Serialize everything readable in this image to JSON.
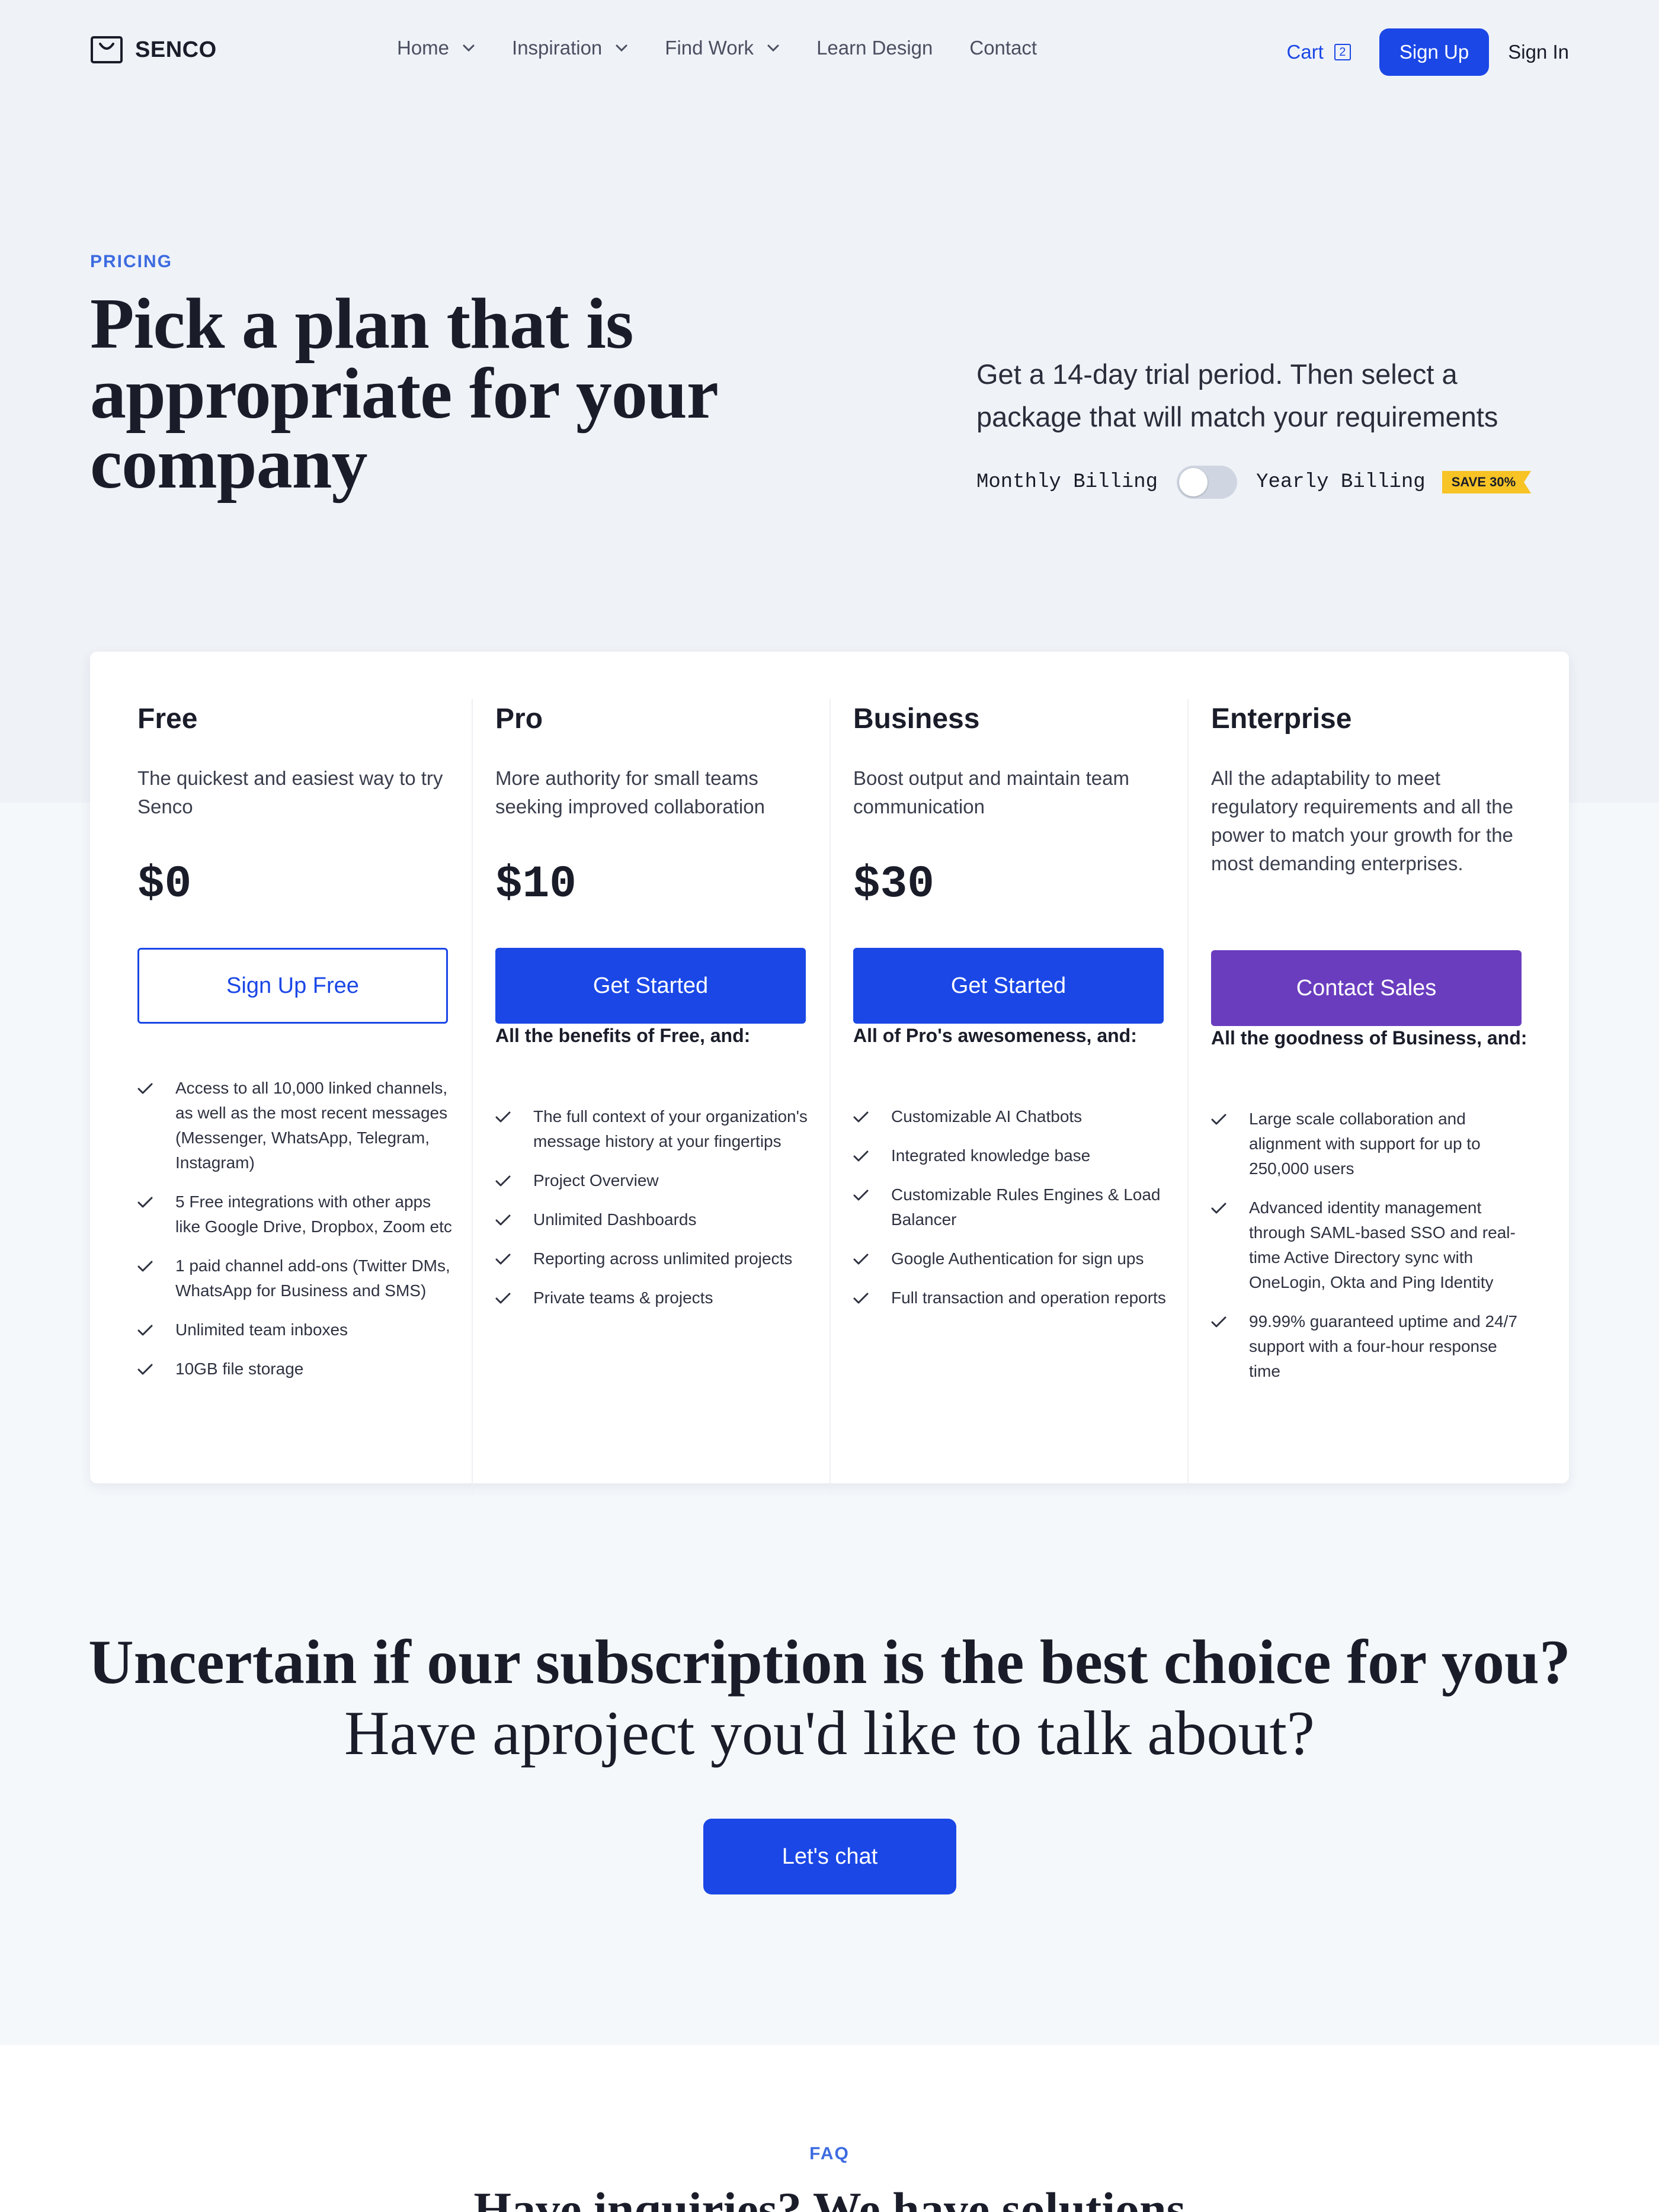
{
  "brand": {
    "name": "SENCO"
  },
  "nav": {
    "links": [
      {
        "label": "Home",
        "has_dropdown": true
      },
      {
        "label": "Inspiration",
        "has_dropdown": true
      },
      {
        "label": "Find Work",
        "has_dropdown": true
      },
      {
        "label": "Learn Design",
        "has_dropdown": false
      },
      {
        "label": "Contact",
        "has_dropdown": false
      }
    ],
    "cart_label": "Cart",
    "cart_count": "2",
    "signup_label": "Sign Up",
    "signin_label": "Sign In"
  },
  "hero": {
    "eyebrow": "PRICING",
    "title": "Pick a plan that is appropriate for your company",
    "subtitle": "Get a 14-day trial period. Then select a package that will match your requirements",
    "billing": {
      "monthly_label": "Monthly Billing",
      "yearly_label": "Yearly Billing",
      "save_badge": "SAVE 30%",
      "yearly_selected": false
    }
  },
  "plans": [
    {
      "name": "Free",
      "description": "The quickest and easiest way to try Senco",
      "price": "$0",
      "button_label": "Sign Up Free",
      "button_style": "outline",
      "features_heading": "",
      "features": [
        "Access to all 10,000 linked channels, as well as the most recent messages (Messenger, WhatsApp, Telegram, Instagram)",
        "5 Free integrations with other apps like Google Drive, Dropbox, Zoom etc",
        "1 paid channel add-ons (Twitter DMs, WhatsApp for Business and SMS)",
        "Unlimited team inboxes",
        "10GB file storage"
      ]
    },
    {
      "name": "Pro",
      "description": "More authority for small teams seeking improved collaboration",
      "price": "$10",
      "button_label": "Get Started",
      "button_style": "blue",
      "features_heading": "All the benefits of Free, and:",
      "features": [
        "The full context of your organization's message history at your fingertips",
        "Project Overview",
        "Unlimited Dashboards",
        "Reporting across unlimited projects",
        "Private teams & projects"
      ]
    },
    {
      "name": "Business",
      "description": "Boost output and maintain team communication",
      "price": "$30",
      "button_label": "Get Started",
      "button_style": "blue",
      "features_heading": "All of Pro's awesomeness, and:",
      "features": [
        "Customizable AI Chatbots",
        "Integrated knowledge base",
        "Customizable Rules Engines & Load Balancer",
        "Google Authentication for sign ups",
        "Full transaction and operation reports"
      ]
    },
    {
      "name": "Enterprise",
      "description": "All the adaptability to meet regulatory requirements and all the power to match your growth for the most demanding enterprises.",
      "price": "",
      "button_label": "Contact Sales",
      "button_style": "purple",
      "features_heading": "All the goodness of Business, and:",
      "features": [
        "Large scale collaboration and alignment with support for up to 250,000 users",
        "Advanced identity management through SAML-based SSO and real-time Active Directory sync with OneLogin, Okta and Ping Identity",
        "99.99% guaranteed uptime and 24/7 support with a four-hour response time"
      ]
    }
  ],
  "cta": {
    "title": "Uncertain if our subscription is the best choice for you?",
    "subtitle": "Have aproject you'd like to talk about?",
    "button_label": "Let's chat"
  },
  "faq": {
    "eyebrow": "FAQ",
    "title": "Have inquiries? We have solutions"
  },
  "colors": {
    "primary": "#1a47e6",
    "enterprise": "#6a3dbf",
    "accent_text": "#3d6be0",
    "save_badge": "#f7c325",
    "hero_bg": "#eff2f7"
  }
}
